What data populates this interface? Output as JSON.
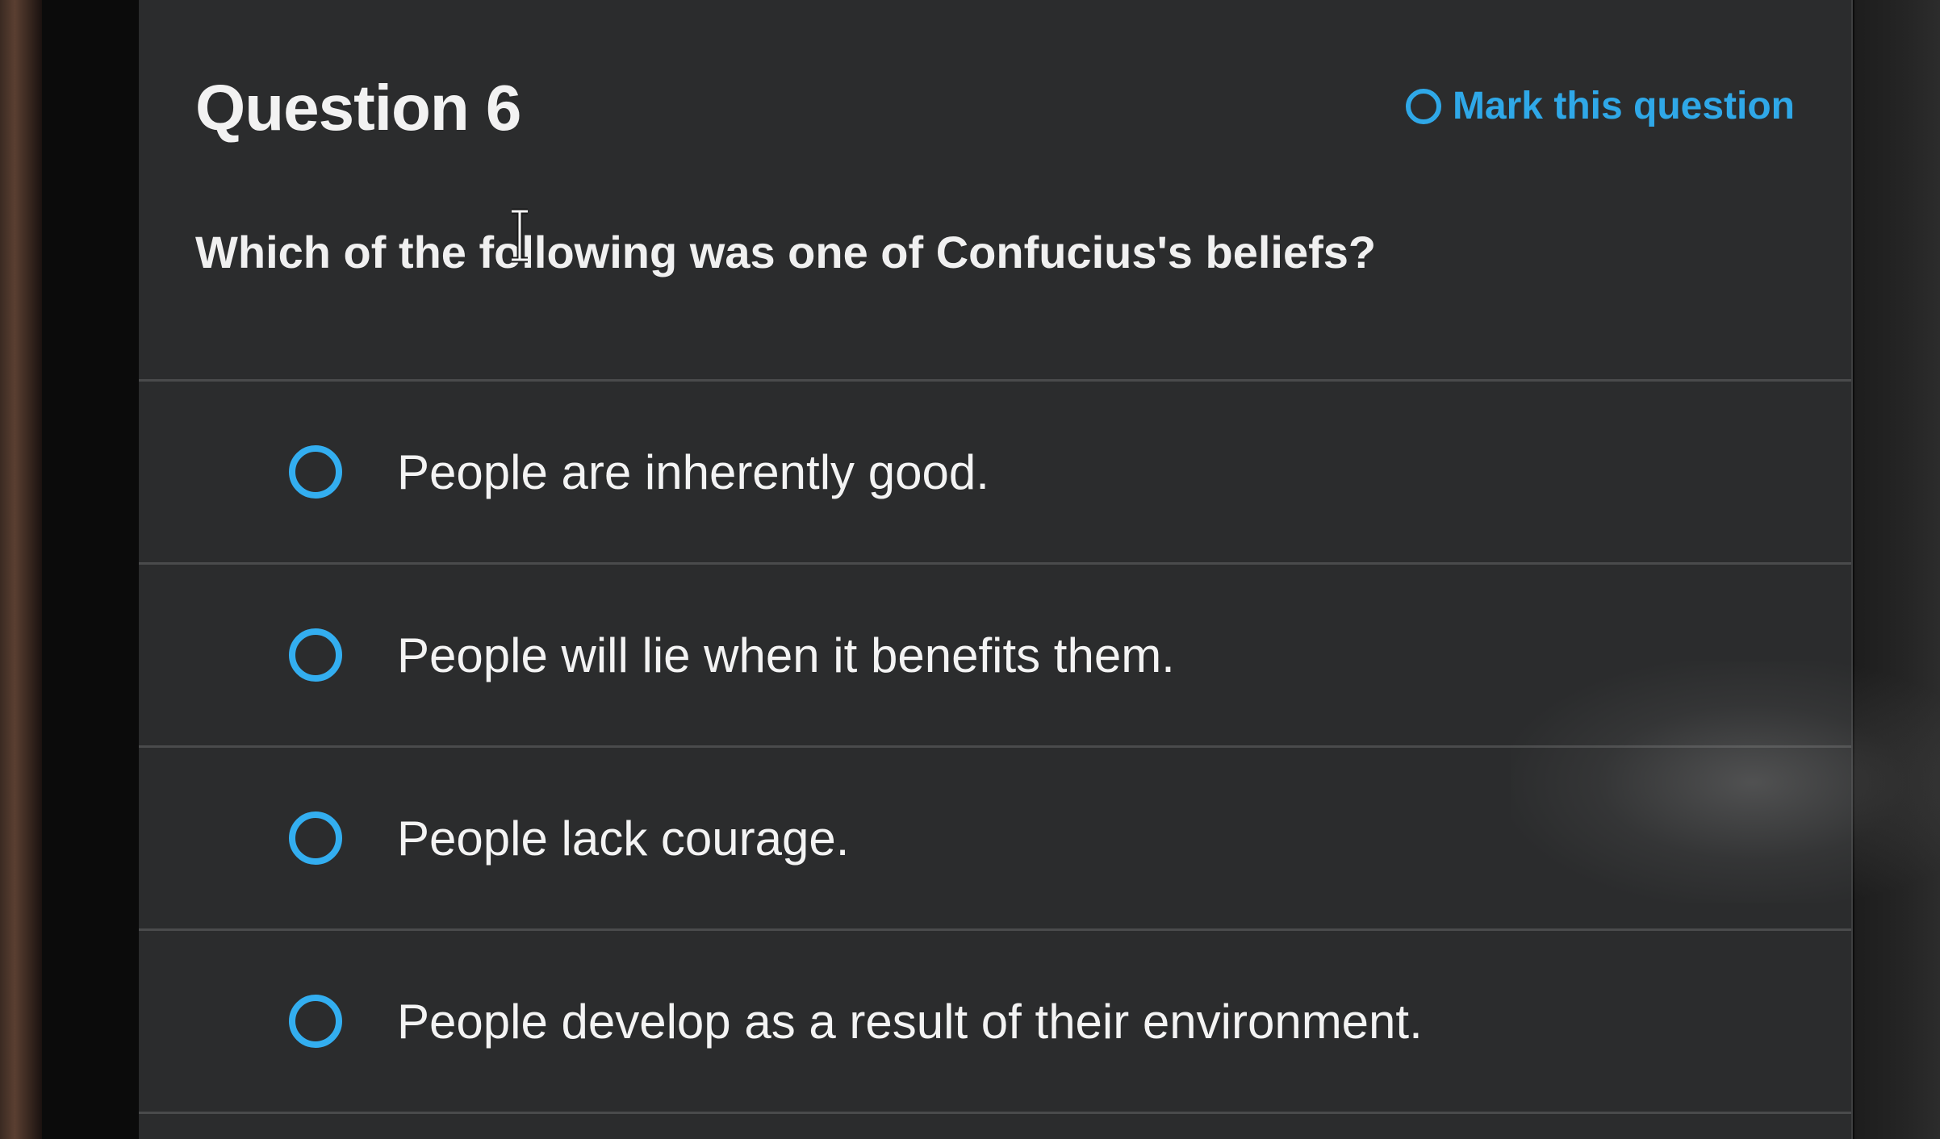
{
  "question": {
    "title": "Question 6",
    "mark_label": "Mark this question",
    "prompt": "Which of the following was one of Confucius's beliefs?"
  },
  "options": [
    {
      "label": "People are inherently good."
    },
    {
      "label": "People will lie when it benefits them."
    },
    {
      "label": "People lack courage."
    },
    {
      "label": "People develop as a result of their environment."
    }
  ],
  "colors": {
    "accent": "#2fa8e8",
    "panel_background": "#2b2c2d",
    "text": "#f2f2f2"
  },
  "icons": {
    "mark": "radio-ring-icon",
    "option": "radio-button-icon",
    "cursor": "text-cursor-icon"
  }
}
